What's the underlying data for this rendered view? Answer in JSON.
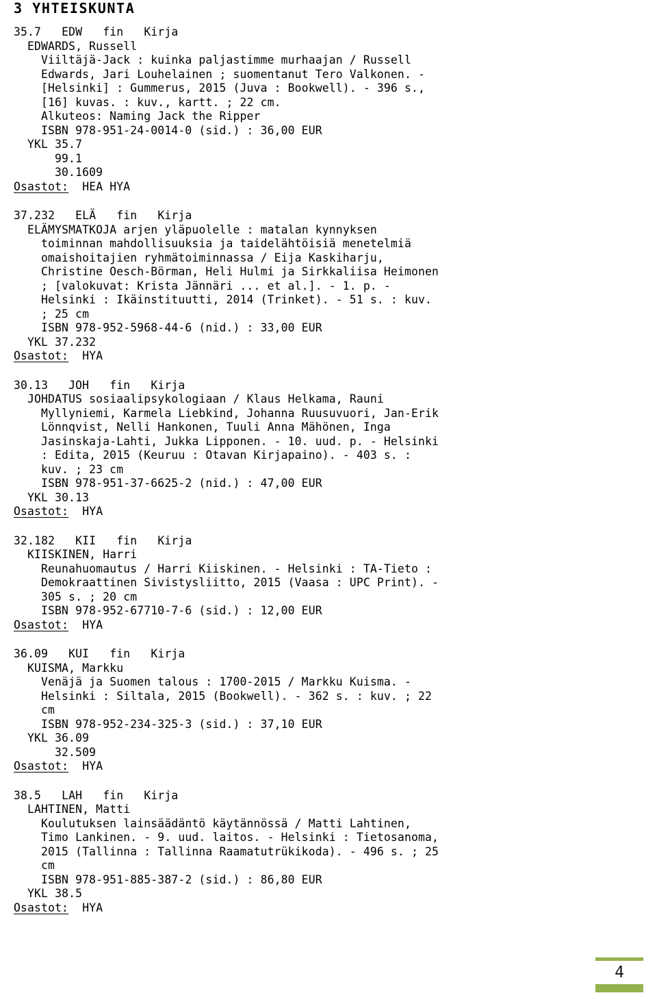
{
  "document": {
    "section_heading": "3 YHTEISKUNTA",
    "accent_color": "#93b34c",
    "page_number": "4",
    "osastot_label": "Osastot:"
  },
  "records": [
    {
      "lines": [
        {
          "indent": 0,
          "text": "35.7   EDW   fin   Kirja"
        },
        {
          "indent": 1,
          "text": "EDWARDS, Russell"
        },
        {
          "indent": 2,
          "text": "Viiltäjä-Jack : kuinka paljastimme murhaajan / Russell"
        },
        {
          "indent": 2,
          "text": "Edwards, Jari Louhelainen ; suomentanut Tero Valkonen. -"
        },
        {
          "indent": 2,
          "text": "[Helsinki] : Gummerus, 2015 (Juva : Bookwell). - 396 s.,"
        },
        {
          "indent": 2,
          "text": "[16] kuvas. : kuv., kartt. ; 22 cm."
        },
        {
          "indent": 2,
          "text": "Alkuteos: Naming Jack the Ripper"
        },
        {
          "indent": 2,
          "text": "ISBN 978-951-24-0014-0 (sid.) : 36,00 EUR"
        },
        {
          "indent": 1,
          "text": "YKL 35.7"
        },
        {
          "indent": 3,
          "text": "99.1"
        },
        {
          "indent": 3,
          "text": "30.1609"
        }
      ],
      "osastot_value": "HEA HYA"
    },
    {
      "lines": [
        {
          "indent": 0,
          "text": "37.232   ELÄ   fin   Kirja"
        },
        {
          "indent": 1,
          "text": "ELÄMYSMATKOJA arjen yläpuolelle : matalan kynnyksen"
        },
        {
          "indent": 2,
          "text": "toiminnan mahdollisuuksia ja taidelähtöisiä menetelmiä"
        },
        {
          "indent": 2,
          "text": "omaishoitajien ryhmätoiminnassa / Eija Kaskiharju,"
        },
        {
          "indent": 2,
          "text": "Christine Oesch-Börman, Heli Hulmi ja Sirkkaliisa Heimonen"
        },
        {
          "indent": 2,
          "text": "; [valokuvat: Krista Jännäri ... et al.]. - 1. p. -"
        },
        {
          "indent": 2,
          "text": "Helsinki : Ikäinstituutti, 2014 (Trinket). - 51 s. : kuv."
        },
        {
          "indent": 2,
          "text": "; 25 cm"
        },
        {
          "indent": 2,
          "text": "ISBN 978-952-5968-44-6 (nid.) : 33,00 EUR"
        },
        {
          "indent": 1,
          "text": "YKL 37.232"
        }
      ],
      "osastot_value": "HYA"
    },
    {
      "lines": [
        {
          "indent": 0,
          "text": "30.13   JOH   fin   Kirja"
        },
        {
          "indent": 1,
          "text": "JOHDATUS sosiaalipsykologiaan / Klaus Helkama, Rauni"
        },
        {
          "indent": 2,
          "text": "Myllyniemi, Karmela Liebkind, Johanna Ruusuvuori, Jan-Erik"
        },
        {
          "indent": 2,
          "text": "Lönnqvist, Nelli Hankonen, Tuuli Anna Mähönen, Inga"
        },
        {
          "indent": 2,
          "text": "Jasinskaja-Lahti, Jukka Lipponen. - 10. uud. p. - Helsinki"
        },
        {
          "indent": 2,
          "text": ": Edita, 2015 (Keuruu : Otavan Kirjapaino). - 403 s. :"
        },
        {
          "indent": 2,
          "text": "kuv. ; 23 cm"
        },
        {
          "indent": 2,
          "text": "ISBN 978-951-37-6625-2 (nid.) : 47,00 EUR"
        },
        {
          "indent": 1,
          "text": "YKL 30.13"
        }
      ],
      "osastot_value": "HYA"
    },
    {
      "lines": [
        {
          "indent": 0,
          "text": "32.182   KII   fin   Kirja"
        },
        {
          "indent": 1,
          "text": "KIISKINEN, Harri"
        },
        {
          "indent": 2,
          "text": "Reunahuomautus / Harri Kiiskinen. - Helsinki : TA-Tieto :"
        },
        {
          "indent": 2,
          "text": "Demokraattinen Sivistysliitto, 2015 (Vaasa : UPC Print). -"
        },
        {
          "indent": 2,
          "text": "305 s. ; 20 cm"
        },
        {
          "indent": 2,
          "text": "ISBN 978-952-67710-7-6 (sid.) : 12,00 EUR"
        }
      ],
      "osastot_value": "HYA"
    },
    {
      "lines": [
        {
          "indent": 0,
          "text": "36.09   KUI   fin   Kirja"
        },
        {
          "indent": 1,
          "text": "KUISMA, Markku"
        },
        {
          "indent": 2,
          "text": "Venäjä ja Suomen talous : 1700-2015 / Markku Kuisma. -"
        },
        {
          "indent": 2,
          "text": "Helsinki : Siltala, 2015 (Bookwell). - 362 s. : kuv. ; 22"
        },
        {
          "indent": 2,
          "text": "cm"
        },
        {
          "indent": 2,
          "text": "ISBN 978-952-234-325-3 (sid.) : 37,10 EUR"
        },
        {
          "indent": 1,
          "text": "YKL 36.09"
        },
        {
          "indent": 3,
          "text": "32.509"
        }
      ],
      "osastot_value": "HYA"
    },
    {
      "lines": [
        {
          "indent": 0,
          "text": "38.5   LAH   fin   Kirja"
        },
        {
          "indent": 1,
          "text": "LAHTINEN, Matti"
        },
        {
          "indent": 2,
          "text": "Koulutuksen lainsäädäntö käytännössä / Matti Lahtinen,"
        },
        {
          "indent": 2,
          "text": "Timo Lankinen. - 9. uud. laitos. - Helsinki : Tietosanoma,"
        },
        {
          "indent": 2,
          "text": "2015 (Tallinna : Tallinna Raamatutrükikoda). - 496 s. ; 25"
        },
        {
          "indent": 2,
          "text": "cm"
        },
        {
          "indent": 2,
          "text": "ISBN 978-951-885-387-2 (sid.) : 86,80 EUR"
        },
        {
          "indent": 1,
          "text": "YKL 38.5"
        }
      ],
      "osastot_value": "HYA"
    }
  ]
}
